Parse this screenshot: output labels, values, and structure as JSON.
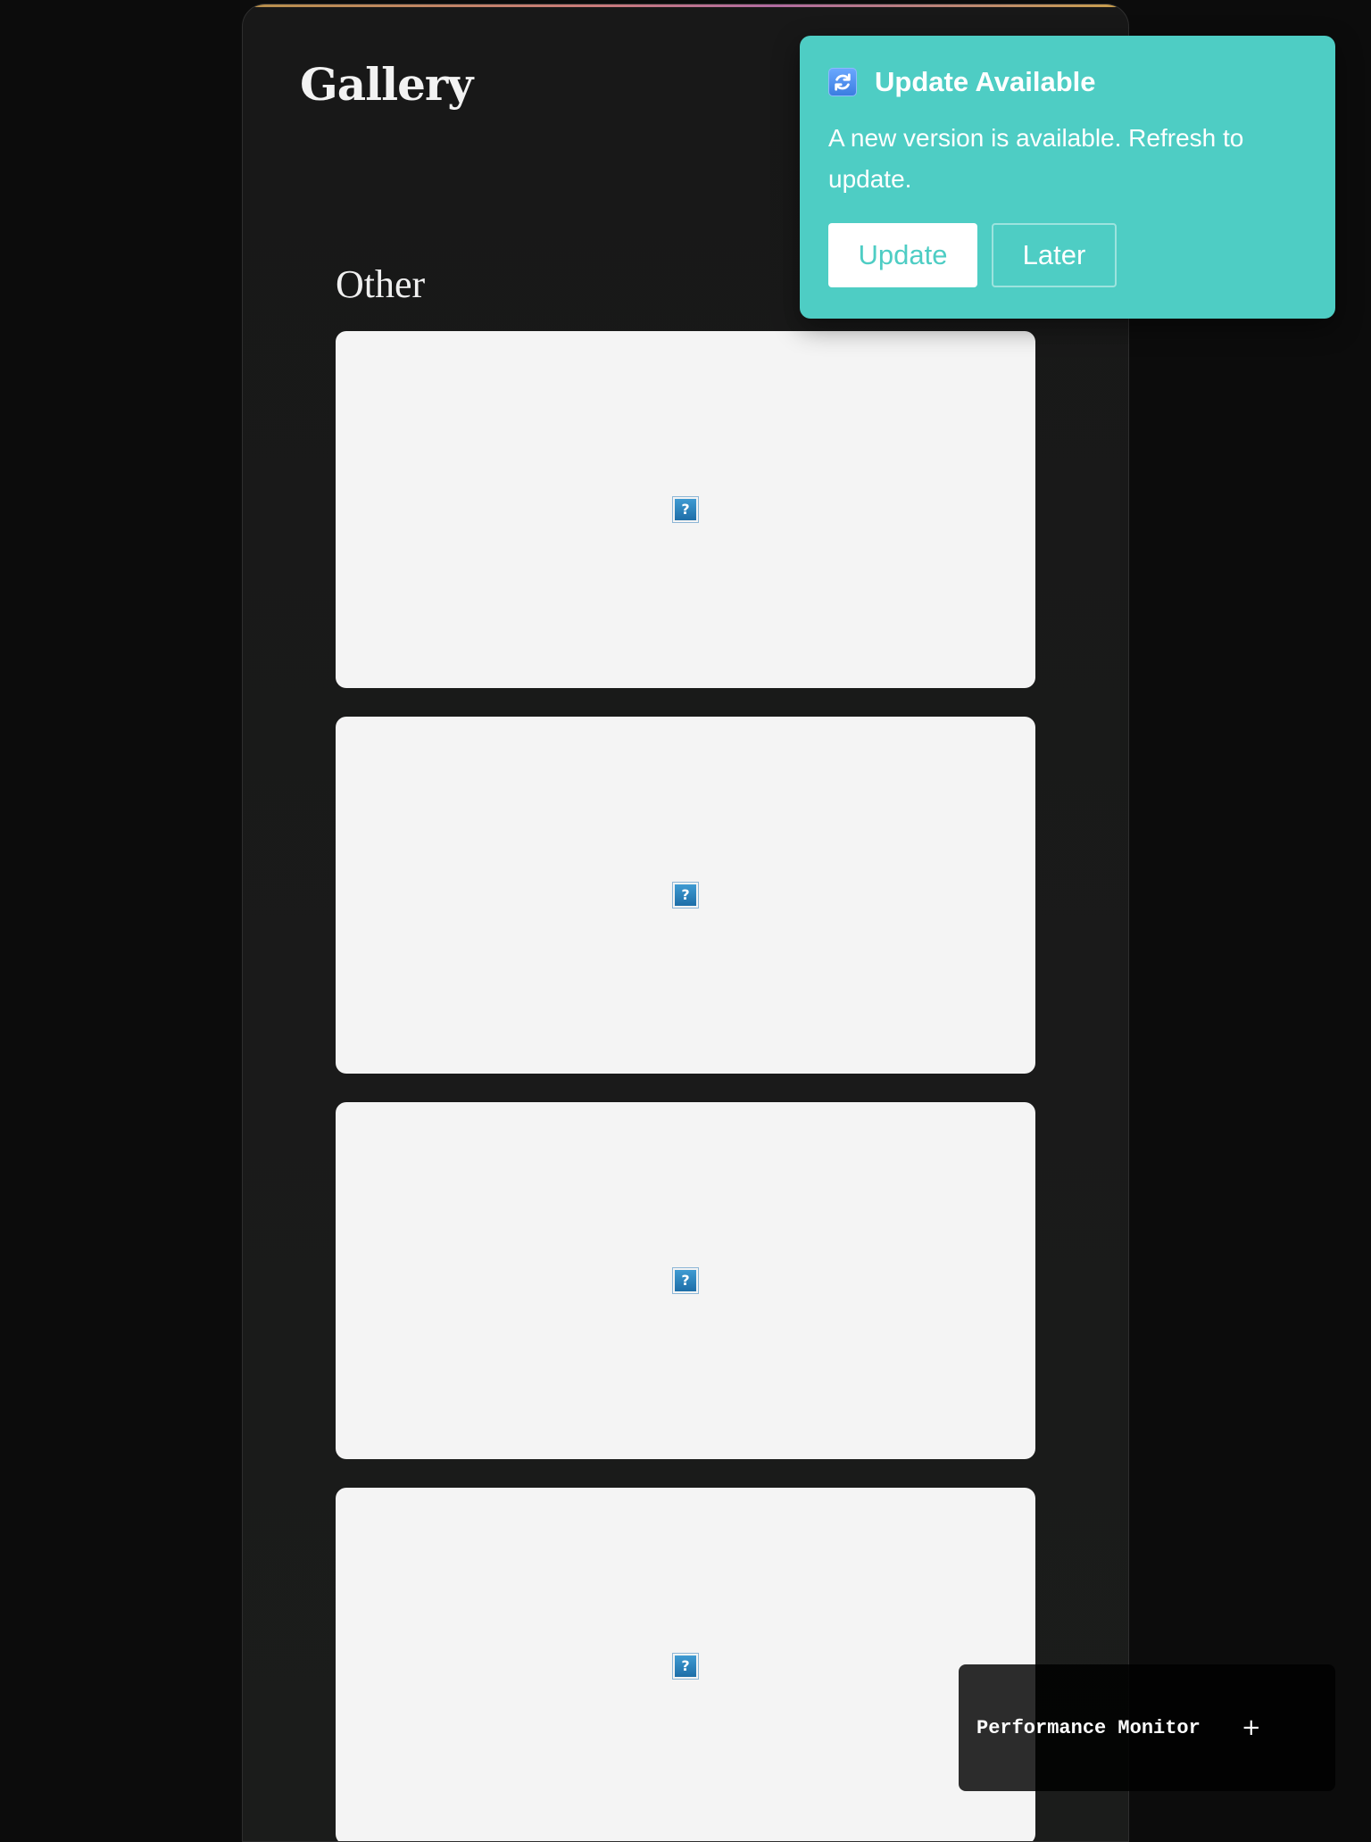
{
  "page": {
    "title": "Gallery"
  },
  "gallery": {
    "section_heading": "Other",
    "cards": [
      {
        "image_alt": "?"
      },
      {
        "image_alt": "?"
      },
      {
        "image_alt": "?"
      },
      {
        "image_alt": "?"
      }
    ]
  },
  "toast": {
    "title": "Update Available",
    "message": "A new version is available. Refresh to update.",
    "update_label": "Update",
    "later_label": "Later",
    "icon": "refresh-icon",
    "background_color": "#4ecdc4"
  },
  "perf_monitor": {
    "title": "Performance Monitor",
    "toggle": "+"
  },
  "colors": {
    "page_background": "#0c0c0c",
    "card_background": "#f4f4f4",
    "accent": "#4ecdc4"
  }
}
